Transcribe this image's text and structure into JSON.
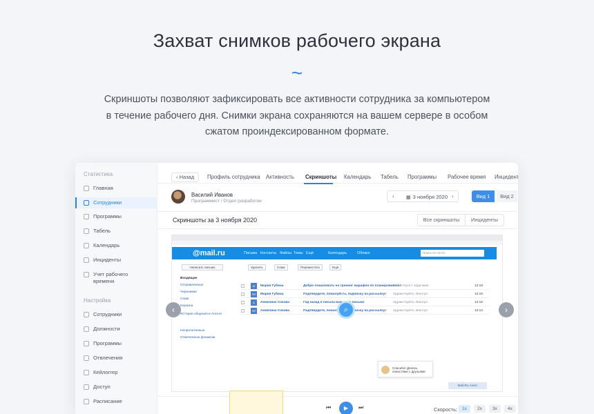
{
  "hero": {
    "title": "Захват снимков рабочего экрана",
    "decor": "~",
    "desc_line1": "Скриншоты позволяют зафиксировать все активности сотрудника за компьютером",
    "desc_line2": "в течение рабочего дня. Снимки экрана сохраняются на вашем сервере в особом",
    "desc_line3": "сжатом проиндексированном формате."
  },
  "sidebar": {
    "section1": "Статистика",
    "items1": [
      {
        "label": "Главная",
        "icon": "grid-icon"
      },
      {
        "label": "Сотрудники",
        "icon": "user-icon"
      },
      {
        "label": "Программы",
        "icon": "window-icon"
      },
      {
        "label": "Табель",
        "icon": "table-icon"
      },
      {
        "label": "Календарь",
        "icon": "calendar-icon"
      },
      {
        "label": "Инциденты",
        "icon": "incident-icon"
      },
      {
        "label": "Учет рабочего времени",
        "icon": "clock-icon"
      }
    ],
    "section2": "Настройка",
    "items2": [
      {
        "label": "Сотрудники",
        "icon": "user-icon"
      },
      {
        "label": "Должности",
        "icon": "briefcase-icon"
      },
      {
        "label": "Программы",
        "icon": "window-icon"
      },
      {
        "label": "Отвлечения",
        "icon": "distraction-icon"
      },
      {
        "label": "Кейлоггер",
        "icon": "keyboard-icon"
      },
      {
        "label": "Доступ",
        "icon": "lock-icon"
      },
      {
        "label": "Расписание",
        "icon": "schedule-icon"
      }
    ],
    "active_color": "#2e80e0"
  },
  "tabs": {
    "back": "‹ Назад",
    "items": [
      "Профиль сотрудника",
      "Активность",
      "Скриншоты",
      "Календарь",
      "Табель",
      "Программы",
      "Рабочее время",
      "Инциденты"
    ],
    "active": "Скриншоты"
  },
  "user": {
    "name": "Василий Иванов",
    "role": "Программист / Отдел разработки"
  },
  "date_picker": {
    "prev": "‹",
    "value": "3 ноября 2020",
    "next": "›"
  },
  "views": {
    "view1": "Вид 1",
    "view2": "Вид 2"
  },
  "section": {
    "title": "Скриншоты за 3 ноября 2020",
    "all_label": "Все скриншоты",
    "incidents_label": "Инциденты"
  },
  "screenshot": {
    "logo": "@mail.ru",
    "nav": [
      "Письма",
      "Контакты",
      "Файлы",
      "Темы",
      "Ещё",
      "Календарь",
      "Облако"
    ],
    "search": "Поиск по почте",
    "toolbar": [
      "Удалить",
      "Спам",
      "Переместить",
      "Ещё"
    ],
    "write_btn": "Написать письмо",
    "folders": [
      "Входящие",
      "Отправленные",
      "Черновики",
      "Спам",
      "Корзина",
      "История общения в Агенте",
      "Непрочитанные",
      "Отмеченные флажком"
    ],
    "rows": [
      {
        "from": "Мария Губина",
        "subject": "Добро пожаловать на тренинг марафон по планированию!",
        "snippet": "Мой отпуск с задачами",
        "time": "12:18"
      },
      {
        "from": "Мария Губина",
        "subject": "Подтвердите, пожалуйста, подписку на рассылку!",
        "snippet": "Здравствуйте, Виктор!",
        "time": "12:16"
      },
      {
        "from": "Анжелика Сокова",
        "subject": "Год назад я писала вам одно письмо",
        "snippet": "Здравствуйте, Виктор!",
        "time": "12:15"
      },
      {
        "from": "Анжелика Сокова",
        "subject": "Подтвердите, пожалуйста, подписку на рассылку!",
        "snippet": "Здравствуйте, Виктор!",
        "time": "12:12"
      }
    ],
    "popup": "Спасибо! Делись новостями с друзьями",
    "footer_btn": "Mail.Ru Агент"
  },
  "player": {
    "prev": "⏮",
    "play": "▶",
    "next": "⏭",
    "speed_label": "Скорость:",
    "speeds": [
      "1x",
      "2x",
      "3x",
      "4x"
    ],
    "active_speed": "1x"
  }
}
